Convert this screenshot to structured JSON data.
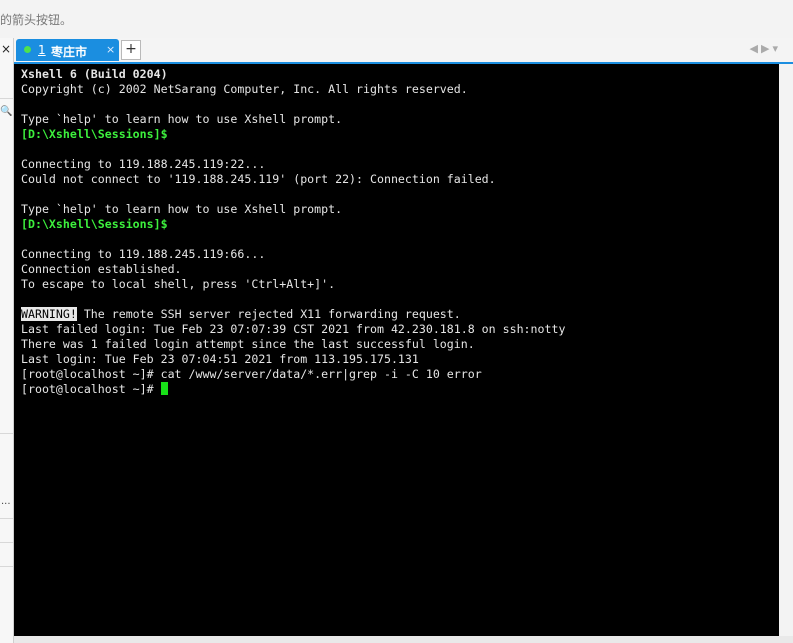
{
  "top_hint": "的箭头按钮。",
  "side_panel": {
    "close_glyph": "×",
    "search_glyph": "🔍",
    "more_glyph": "..."
  },
  "tab": {
    "number": "1",
    "title": "枣庄市",
    "close_glyph": "×"
  },
  "add_tab_glyph": "+",
  "tab_nav": {
    "prev_glyph": "◀",
    "next_glyph": "▶",
    "menu_glyph": "▾"
  },
  "terminal": {
    "header_title": "Xshell 6 (Build 0204)",
    "copyright": "Copyright (c) 2002 NetSarang Computer, Inc. All rights reserved.",
    "help_1": "Type `help' to learn how to use Xshell prompt.",
    "prompt_1": "[D:\\Xshell\\Sessions]$",
    "connecting_1": "Connecting to 119.188.245.119:22...",
    "fail_1": "Could not connect to '119.188.245.119' (port 22): Connection failed.",
    "help_2": "Type `help' to learn how to use Xshell prompt.",
    "prompt_2": "[D:\\Xshell\\Sessions]$",
    "connecting_2": "Connecting to 119.188.245.119:66...",
    "established": "Connection established.",
    "escape_hint": "To escape to local shell, press 'Ctrl+Alt+]'.",
    "warning_tag": "WARNING!",
    "warning_text": " The remote SSH server rejected X11 forwarding request.",
    "last_failed": "Last failed login: Tue Feb 23 07:07:39 CST 2021 from 42.230.181.8 on ssh:notty",
    "failed_count": "There was 1 failed login attempt since the last successful login.",
    "last_login": "Last login: Tue Feb 23 07:04:51 2021 from 113.195.175.131",
    "cmd_line": "[root@localhost ~]# cat /www/server/data/*.err|grep -i -C 10 error",
    "current_prompt": "[root@localhost ~]# "
  },
  "colors": {
    "tab_blue": "#1b8ee0",
    "prompt_green": "#3df03d",
    "cursor_green": "#18e018",
    "terminal_bg": "#000000"
  }
}
